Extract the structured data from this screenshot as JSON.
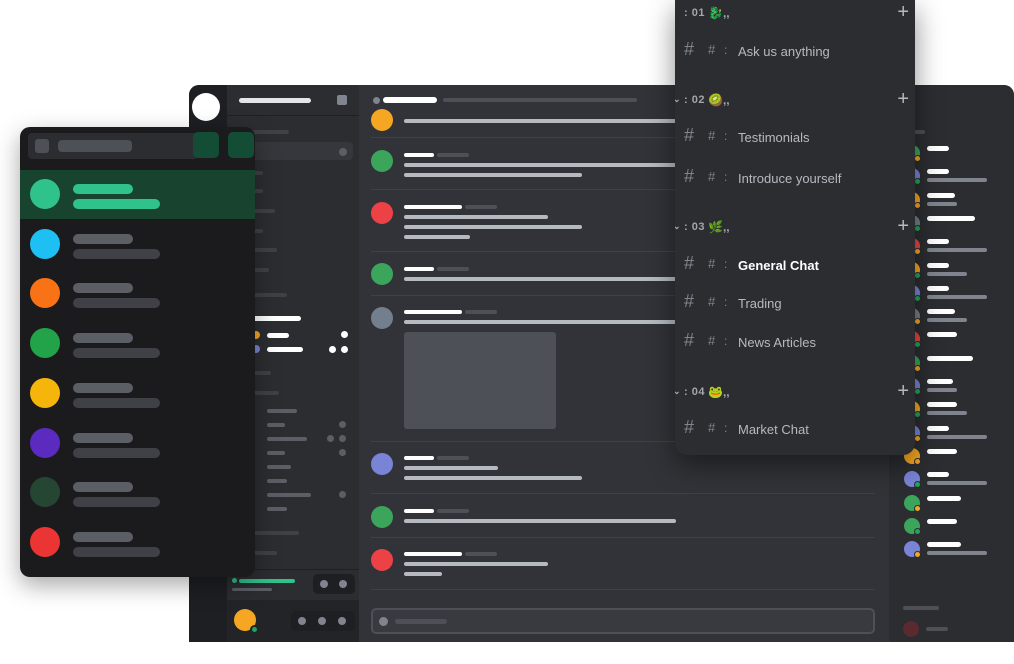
{
  "channel_popup": {
    "categories": [
      {
        "prefix": ": 01",
        "emoji": "🐉,,",
        "channels": [
          {
            "label": "Ask us anything",
            "active": false
          }
        ]
      },
      {
        "prefix": ": 02",
        "emoji": "🥝,,",
        "channels": [
          {
            "label": "Testimonials",
            "active": false
          },
          {
            "label": "Introduce yourself",
            "active": false
          }
        ]
      },
      {
        "prefix": ": 03",
        "emoji": "🌿,,",
        "channels": [
          {
            "label": "General Chat",
            "active": true
          },
          {
            "label": "Trading",
            "active": false
          },
          {
            "label": "News Articles",
            "active": false
          }
        ]
      },
      {
        "prefix": ": 04",
        "emoji": "🐸,,",
        "channels": [
          {
            "label": "Market Chat",
            "active": false
          }
        ]
      }
    ],
    "hash_glyph": "#",
    "small_hash_glyph": "#",
    "colon_glyph": ":",
    "plus_glyph": "+",
    "chevron_glyph": "⌄"
  },
  "dm_list": {
    "avatar_colors": [
      "#2fc28a",
      "#1ec0f4",
      "#f97316",
      "#22a34a",
      "#f5b50a",
      "#5b2bbf",
      "#264634",
      "#eb3434"
    ],
    "selected_index": 0
  },
  "chat": {
    "avatar_colors": [
      "#f5a623",
      "#3ba55c",
      "#ed4245",
      "#3ba55c",
      "#747f8d",
      "#7984d6",
      "#3ba55c",
      "#ed4245"
    ]
  },
  "colors": {
    "accent_green": "#2fc28a",
    "app_bg": "#313338",
    "sidebar_bg": "#2b2d31",
    "rail_bg": "#1e1f22"
  }
}
